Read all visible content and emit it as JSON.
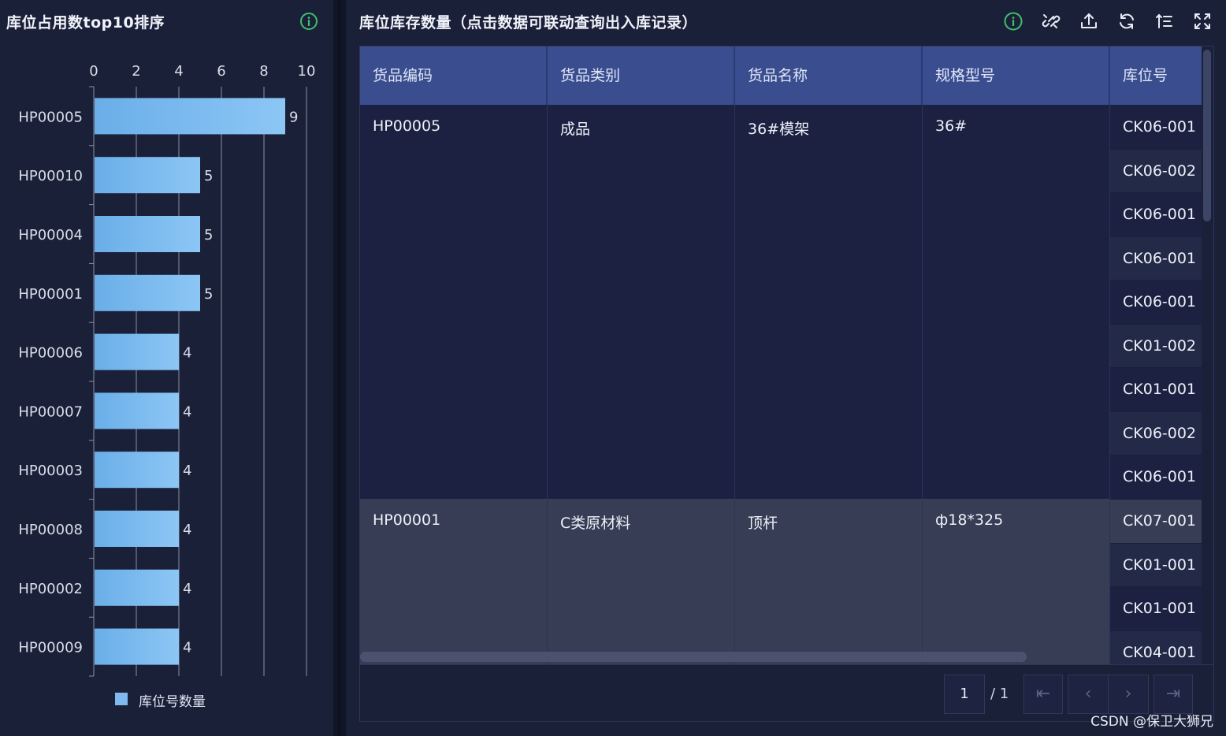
{
  "left_panel": {
    "title": "库位占用数top10排序",
    "info_icon": "info-circle-icon",
    "legend_label": "库位号数量"
  },
  "chart_data": {
    "type": "bar",
    "orientation": "horizontal",
    "categories": [
      "HP00005",
      "HP00010",
      "HP00004",
      "HP00001",
      "HP00006",
      "HP00007",
      "HP00003",
      "HP00008",
      "HP00002",
      "HP00009"
    ],
    "series": [
      {
        "name": "库位号数量",
        "values": [
          9,
          5,
          5,
          5,
          4,
          4,
          4,
          4,
          4,
          4
        ]
      }
    ],
    "xlim": [
      0,
      10
    ],
    "x_ticks": [
      "0",
      "2",
      "4",
      "6",
      "8",
      "10"
    ],
    "x_axis_position": "top",
    "data_labels": [
      "9",
      "5",
      "5",
      "5",
      "4",
      "4",
      "4",
      "4",
      "4",
      "4"
    ],
    "grid": true,
    "legend_position": "bottom",
    "bar_color": "#7fb9ef"
  },
  "right_panel": {
    "title": "库位库存数量（点击数据可联动查询出入库记录）",
    "toolbar_icons": [
      "info-circle-icon",
      "unlink-icon",
      "export-icon",
      "refresh-icon",
      "sort-icon",
      "fullscreen-icon"
    ],
    "columns": [
      "货品编码",
      "货品类别",
      "货品名称",
      "规格型号",
      "库位号"
    ],
    "groups": [
      {
        "code": "HP00005",
        "category": "成品",
        "name": "36#模架",
        "spec": "36#",
        "locations": [
          "CK06-001",
          "CK06-002",
          "CK06-001",
          "CK06-001",
          "CK06-001",
          "CK01-002",
          "CK01-001",
          "CK06-002",
          "CK06-001"
        ]
      },
      {
        "code": "HP00001",
        "category": "C类原材料",
        "name": "顶杆",
        "spec": "ф18*325",
        "locations": [
          "CK07-001",
          "CK01-001",
          "CK01-001",
          "CK04-001"
        ]
      }
    ],
    "pagination": {
      "current": "1",
      "total_text": "/ 1",
      "first": "⇤",
      "prev": "‹",
      "next": "›",
      "last": "⇥"
    }
  },
  "watermark": "CSDN @保卫大狮兄",
  "colors": {
    "header_bg": "#3a4d8f",
    "bar": "#7fb9ef",
    "info_green": "#3fbf6a",
    "page_bg": "#1b2039"
  }
}
